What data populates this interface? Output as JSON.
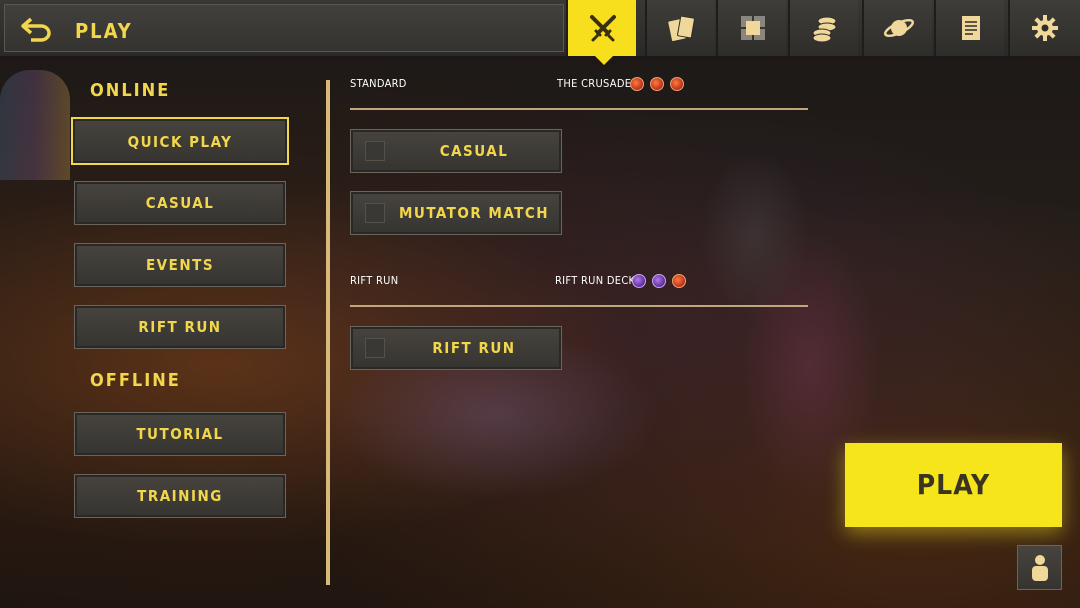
{
  "header": {
    "title": "PLAY",
    "back_icon": "back-arrow-icon",
    "tabs": [
      {
        "name": "play",
        "icon": "crossed-swords-icon",
        "active": true
      },
      {
        "name": "cards",
        "icon": "cards-icon",
        "active": false
      },
      {
        "name": "decks",
        "icon": "deck-builder-icon",
        "active": false
      },
      {
        "name": "shop",
        "icon": "coins-icon",
        "active": false
      },
      {
        "name": "world",
        "icon": "planet-icon",
        "active": false
      },
      {
        "name": "quests",
        "icon": "scroll-icon",
        "active": false
      },
      {
        "name": "settings",
        "icon": "gear-icon",
        "active": false
      }
    ]
  },
  "nav": {
    "online_label": "ONLINE",
    "offline_label": "OFFLINE",
    "online_items": [
      {
        "label": "QUICK PLAY",
        "selected": true
      },
      {
        "label": "CASUAL",
        "selected": false
      },
      {
        "label": "EVENTS",
        "selected": false
      },
      {
        "label": "RIFT RUN",
        "selected": false
      }
    ],
    "offline_items": [
      {
        "label": "TUTORIAL",
        "selected": false
      },
      {
        "label": "TRAINING",
        "selected": false
      }
    ]
  },
  "panel": {
    "standard": {
      "label": "STANDARD",
      "deck_name": "THE CRUSADE",
      "deck_factions": [
        "red",
        "red",
        "red"
      ],
      "modes": [
        {
          "label": "CASUAL",
          "checked": false
        },
        {
          "label": "MUTATOR MATCH",
          "checked": false
        }
      ]
    },
    "rift_run": {
      "label": "RIFT RUN",
      "deck_name": "RIFT RUN DECK",
      "deck_factions": [
        "purple",
        "purple",
        "red"
      ],
      "modes": [
        {
          "label": "RIFT RUN",
          "checked": false
        }
      ]
    }
  },
  "play_button": {
    "label": "PLAY"
  },
  "profile_icon": "profile-icon",
  "colors": {
    "accent": "#f7df1e",
    "text": "#f2d64b",
    "panel": "#3a3835"
  }
}
